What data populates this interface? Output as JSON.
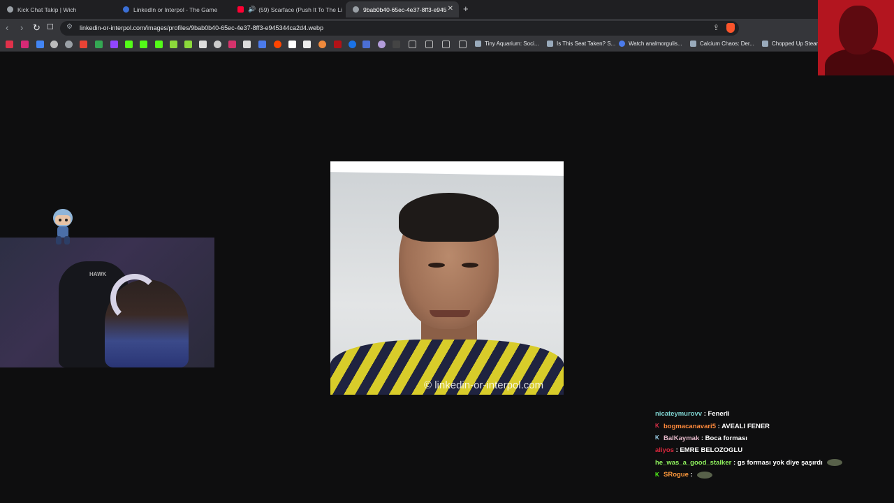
{
  "tabs": [
    {
      "label": "Kick Chat Takip | Wich",
      "icon_color": "#9aa0a6",
      "active": false
    },
    {
      "label": "LinkedIn or Interpol - The Game",
      "icon_color": "#3b6fd6",
      "active": false
    },
    {
      "label": "(59) Scarface (Push It To The Limit",
      "icon_color": "#ff0033",
      "active": false
    },
    {
      "label": "9bab0b40-65ec-4e37-8ff3-e945",
      "icon_color": "#9aa0a6",
      "active": true
    }
  ],
  "tab_close_glyph": "✕",
  "new_tab_glyph": "+",
  "nav": {
    "back": "‹",
    "forward": "›",
    "reload": "↻",
    "bookmark": "☐"
  },
  "address": {
    "url": "linkedin-or-interpol.com/images/profiles/9bab0b40-65ec-4e37-8ff3-e945344ca2d4.webp",
    "tune_glyph": "⚙"
  },
  "bookmarks_text": [
    "Tiny Aquarium: Soci...",
    "Is This Seat Taken? S...",
    "Watch analmorgulis...",
    "Calcium Chaos: Der...",
    "Chopped Up Steam"
  ],
  "image": {
    "watermark": "© linkedin-or-interpol.com"
  },
  "chat": [
    {
      "user": "nicateymurovv",
      "color": "#7fd3d0",
      "badge": "",
      "badge_color": "",
      "message": ": Fenerli",
      "emote": false
    },
    {
      "user": "bogmacanavari5",
      "color": "#ff8a3c",
      "badge": "K",
      "badge_color": "#e0314a",
      "message": ": AVEALI FENER",
      "emote": false
    },
    {
      "user": "BalKaymak",
      "color": "#e3b7c8",
      "badge": "K",
      "badge_color": "#9fd4ee",
      "message": ": Boca forması",
      "emote": false
    },
    {
      "user": "aliyos",
      "color": "#d8273c",
      "badge": "",
      "badge_color": "",
      "message": ": EMRE BELOZOGLU",
      "emote": false
    },
    {
      "user": "he_was_a_good_stalker",
      "color": "#8ff25e",
      "badge": "",
      "badge_color": "",
      "message": ": gs forması yok diye şaşırdı",
      "emote": true
    },
    {
      "user": "SRogue",
      "color": "#ff9a3c",
      "badge": "K",
      "badge_color": "#53fc18",
      "message": ":",
      "emote": true
    }
  ],
  "colors": {
    "background": "#0e0e0f",
    "toolbar": "#35363a",
    "kick_green": "#53fc18"
  }
}
